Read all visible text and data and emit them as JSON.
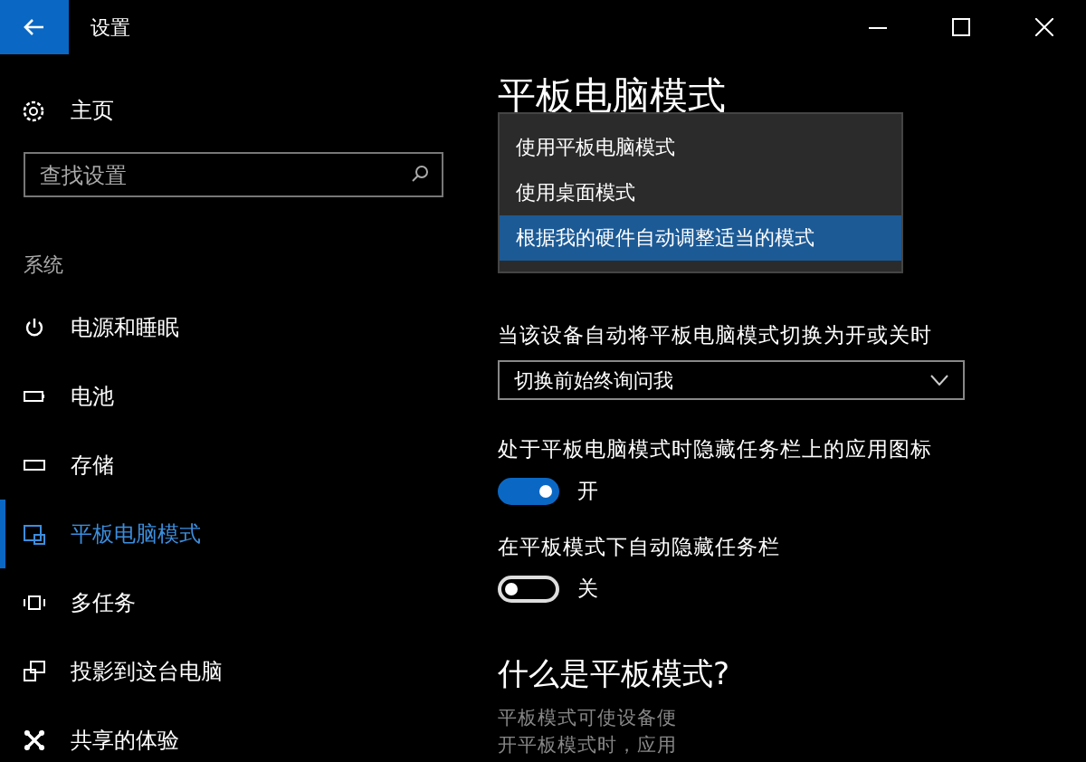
{
  "window": {
    "title": "设置"
  },
  "sidebar": {
    "home": "主页",
    "search": {
      "placeholder": "查找设置"
    },
    "section": "系统",
    "items": [
      {
        "label": "电源和睡眠",
        "kind": "power",
        "selected": false
      },
      {
        "label": "电池",
        "kind": "battery",
        "selected": false
      },
      {
        "label": "存储",
        "kind": "storage",
        "selected": false
      },
      {
        "label": "平板电脑模式",
        "kind": "tablet",
        "selected": true
      },
      {
        "label": "多任务",
        "kind": "multitask",
        "selected": false
      },
      {
        "label": "投影到这台电脑",
        "kind": "project",
        "selected": false
      },
      {
        "label": "共享的体验",
        "kind": "share",
        "selected": false
      }
    ]
  },
  "page": {
    "title": "平板电脑模式",
    "menu": [
      {
        "label": "使用平板电脑模式",
        "selected": false
      },
      {
        "label": "使用桌面模式",
        "selected": false
      },
      {
        "label": "根据我的硬件自动调整适当的模式",
        "selected": true
      }
    ],
    "switch_label": "当该设备自动将平板电脑模式切换为开或关时",
    "switch_select": "切换前始终询问我",
    "toggles": [
      {
        "label": "处于平板电脑模式时隐藏任务栏上的应用图标",
        "on": true,
        "state": "开"
      },
      {
        "label": "在平板模式下自动隐藏任务栏",
        "on": false,
        "state": "关"
      }
    ],
    "help_title": "什么是平板模式?",
    "help_lines": [
      "平板模式可使设备便",
      "开平板模式时，应用"
    ]
  }
}
